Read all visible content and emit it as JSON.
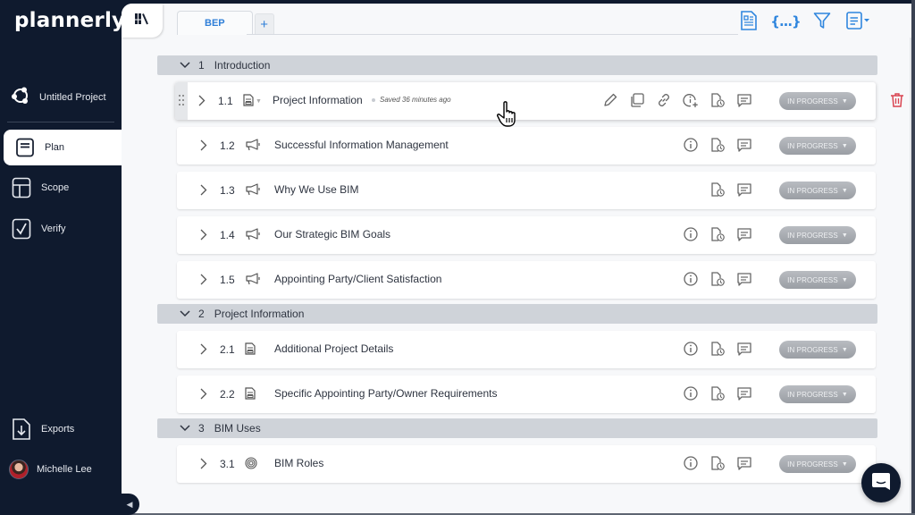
{
  "app": {
    "logo": "plannerly",
    "project_name": "Untitled Project"
  },
  "sidebar": {
    "items": [
      {
        "label": "Plan",
        "icon": "plan-icon",
        "active": true
      },
      {
        "label": "Scope",
        "icon": "scope-icon",
        "active": false
      },
      {
        "label": "Verify",
        "icon": "verify-icon",
        "active": false
      }
    ],
    "exports_label": "Exports",
    "user_name": "Michelle Lee"
  },
  "tabs": {
    "items": [
      {
        "label": "BEP"
      }
    ],
    "add_label": "+"
  },
  "toolbar": {
    "icons": [
      "document-view-icon",
      "variables-icon",
      "filter-icon",
      "template-dropdown-icon"
    ],
    "braces_label": "{...}"
  },
  "sections": [
    {
      "num": "1",
      "title": "Introduction",
      "rows": [
        {
          "num": "1.1",
          "type": "document-icon",
          "title": "Project Information",
          "saved": "Saved 36 minutes ago",
          "status": "IN PROGRESS",
          "hover": true
        },
        {
          "num": "1.2",
          "type": "megaphone-icon",
          "title": "Successful Information Management",
          "status": "IN PROGRESS",
          "info": true
        },
        {
          "num": "1.3",
          "type": "megaphone-icon",
          "title": "Why We Use BIM",
          "status": "IN PROGRESS",
          "info": false
        },
        {
          "num": "1.4",
          "type": "megaphone-icon",
          "title": "Our Strategic BIM Goals",
          "status": "IN PROGRESS",
          "info": true
        },
        {
          "num": "1.5",
          "type": "megaphone-icon",
          "title": "Appointing Party/Client Satisfaction",
          "status": "IN PROGRESS",
          "info": true
        }
      ]
    },
    {
      "num": "2",
      "title": "Project Information",
      "rows": [
        {
          "num": "2.1",
          "type": "document-icon",
          "title": "Additional Project Details",
          "status": "IN PROGRESS",
          "info": true
        },
        {
          "num": "2.2",
          "type": "document-icon",
          "title": "Specific Appointing Party/Owner Requirements",
          "status": "IN PROGRESS",
          "info": true
        }
      ]
    },
    {
      "num": "3",
      "title": "BIM Uses",
      "rows": [
        {
          "num": "3.1",
          "type": "target-icon",
          "title": "BIM Roles",
          "status": "IN PROGRESS",
          "info": true
        }
      ]
    }
  ],
  "colors": {
    "sidebar_bg": "#0f1a2e",
    "accent": "#2f86de",
    "delete": "#d9434f",
    "section_bg": "#cfd3d9",
    "status_pill": "#a7abb1"
  }
}
